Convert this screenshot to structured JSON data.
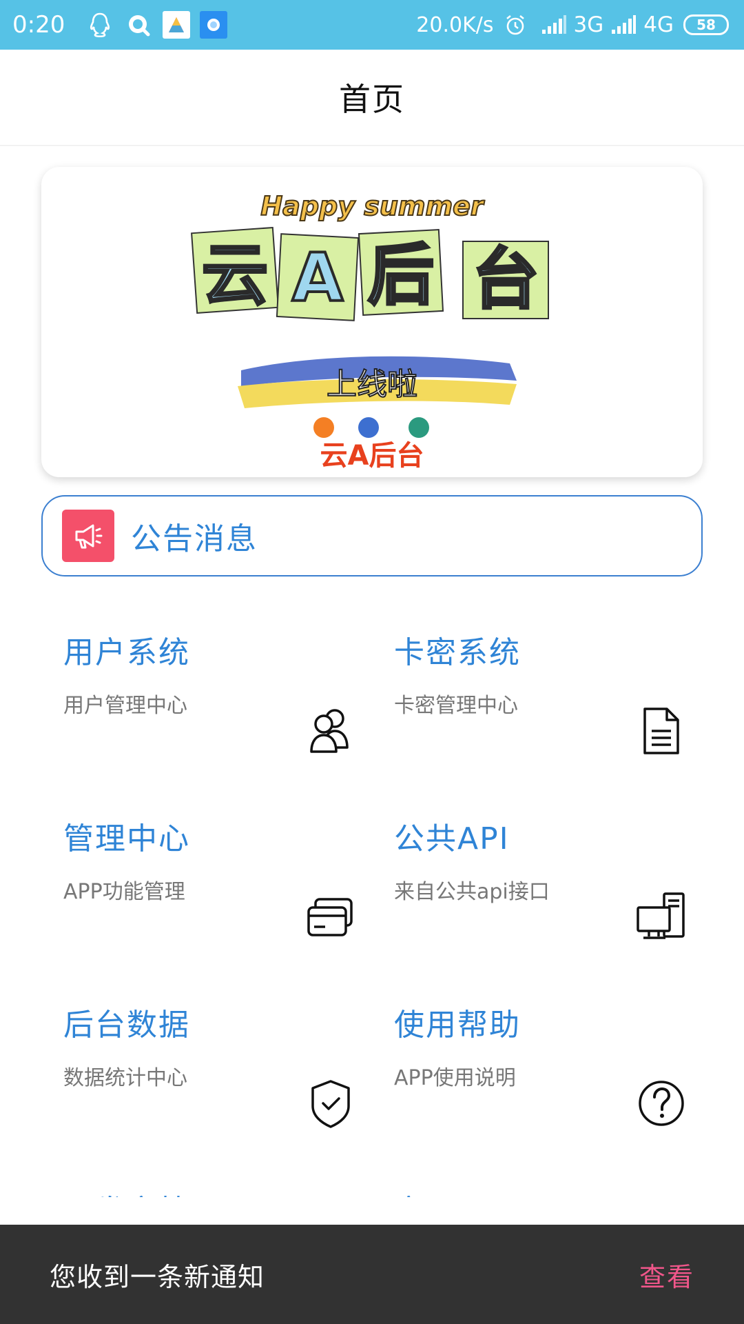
{
  "status_bar": {
    "time": "0:20",
    "net_speed": "20.0K/s",
    "network_1": "3G",
    "network_2": "4G",
    "battery": "58",
    "icons": [
      "qq-icon",
      "browser-icon",
      "app-icon",
      "app-icon",
      "alarm-icon",
      "signal-icon",
      "signal-icon"
    ]
  },
  "header": {
    "title": "首页"
  },
  "banner": {
    "headline": "Happy summer",
    "title_chars": [
      "云",
      "A",
      "后",
      "台"
    ],
    "slogan": "上线啦",
    "brand": "云A后台",
    "dot_colors": [
      "#f47f24",
      "#3d6fd0",
      "#2b9a7f"
    ]
  },
  "notice": {
    "label": "公告消息",
    "icon": "megaphone-icon",
    "icon_bg": "#f4506a"
  },
  "modules": [
    {
      "title": "用户系统",
      "subtitle": "用户管理中心",
      "icon": "users-icon"
    },
    {
      "title": "卡密系统",
      "subtitle": "卡密管理中心",
      "icon": "document-icon"
    },
    {
      "title": "管理中心",
      "subtitle": "APP功能管理",
      "icon": "cards-icon"
    },
    {
      "title": "公共API",
      "subtitle": "来自公共api接口",
      "icon": "computer-icon"
    },
    {
      "title": "后台数据",
      "subtitle": "数据统计中心",
      "icon": "shield-check-icon"
    },
    {
      "title": "使用帮助",
      "subtitle": "APP使用说明",
      "icon": "help-icon"
    },
    {
      "title": "开发文档",
      "subtitle": "",
      "icon": ""
    },
    {
      "title": "实用工具",
      "subtitle": "",
      "icon": ""
    }
  ],
  "snackbar": {
    "message": "您收到一条新通知",
    "action": "查看"
  },
  "colors": {
    "status_bar": "#56c2e6",
    "accent_blue": "#2f84d6",
    "snackbar_bg": "#323232",
    "snackbar_action": "#f0568a"
  }
}
